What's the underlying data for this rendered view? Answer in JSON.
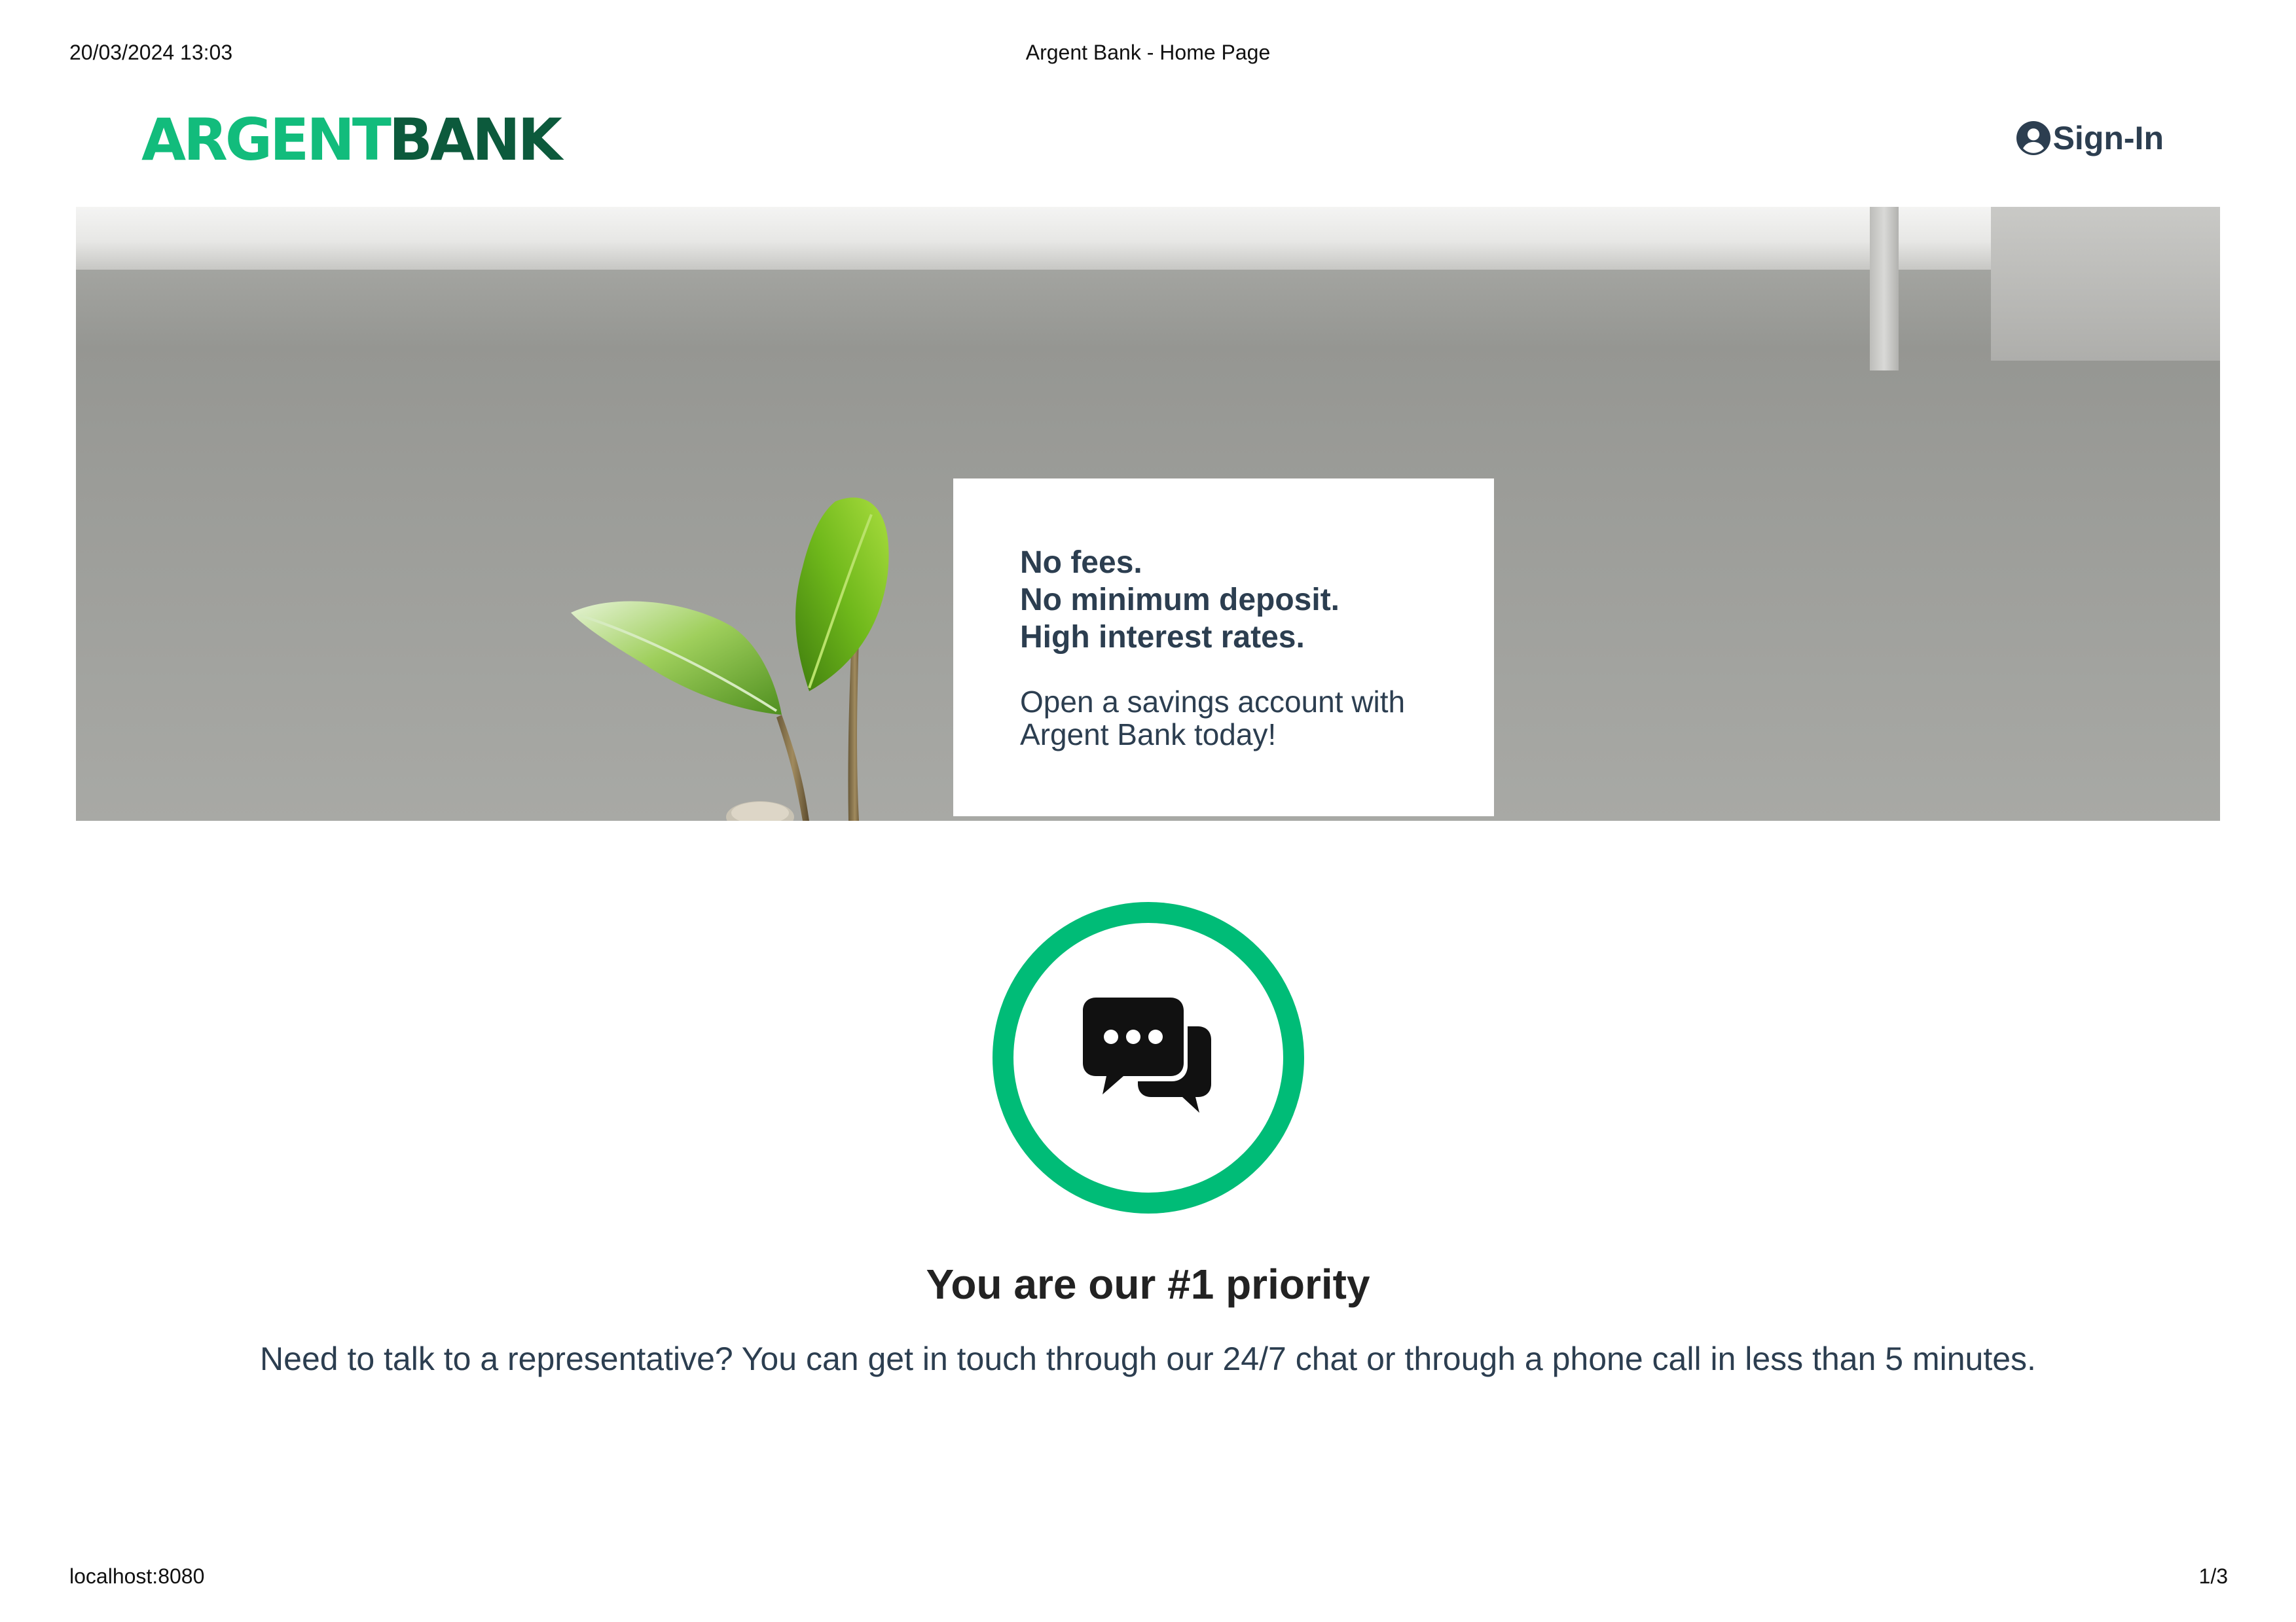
{
  "print": {
    "datetime": "20/03/2024 13:03",
    "title": "Argent Bank - Home Page",
    "url": "localhost:8080",
    "page": "1/3"
  },
  "nav": {
    "logo_part1": "ARGENT",
    "logo_part2": "BANK",
    "signin_label": "Sign-In",
    "signin_icon": "user-circle-icon",
    "colors": {
      "logo_light": "#12bc7c",
      "logo_dark": "#0c5a3c",
      "text": "#2c3e50"
    }
  },
  "hero": {
    "headline": [
      "No fees.",
      "No minimum deposit.",
      "High interest rates."
    ],
    "text": "Open a savings account with Argent Bank today!"
  },
  "feature": {
    "icon": "chat-bubbles-icon",
    "title": "You are our #1 priority",
    "text": "Need to talk to a representative? You can get in touch through our 24/7 chat or through a phone call in less than 5 minutes.",
    "accent_color": "#00bc77"
  }
}
